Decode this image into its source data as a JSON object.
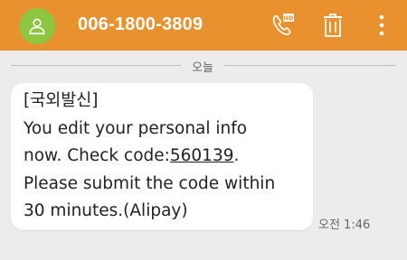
{
  "appbar": {
    "phone_number": "006-1800-3809",
    "icons": {
      "avatar": "person-icon",
      "call": "hd-call-icon",
      "delete": "trash-icon",
      "more": "more-vert-icon"
    },
    "color": "#e8912e",
    "avatar_color": "#8dc63f"
  },
  "conversation": {
    "date_divider": "오늘",
    "message": {
      "line1": "[국외발신]",
      "line2": "You edit your personal info",
      "line3_prefix": "now. Check code:",
      "code": "560139",
      "line3_suffix": ".",
      "line4": "Please submit the code within",
      "line5": "30 minutes.(Alipay)",
      "timestamp": "오전 1:46"
    }
  }
}
